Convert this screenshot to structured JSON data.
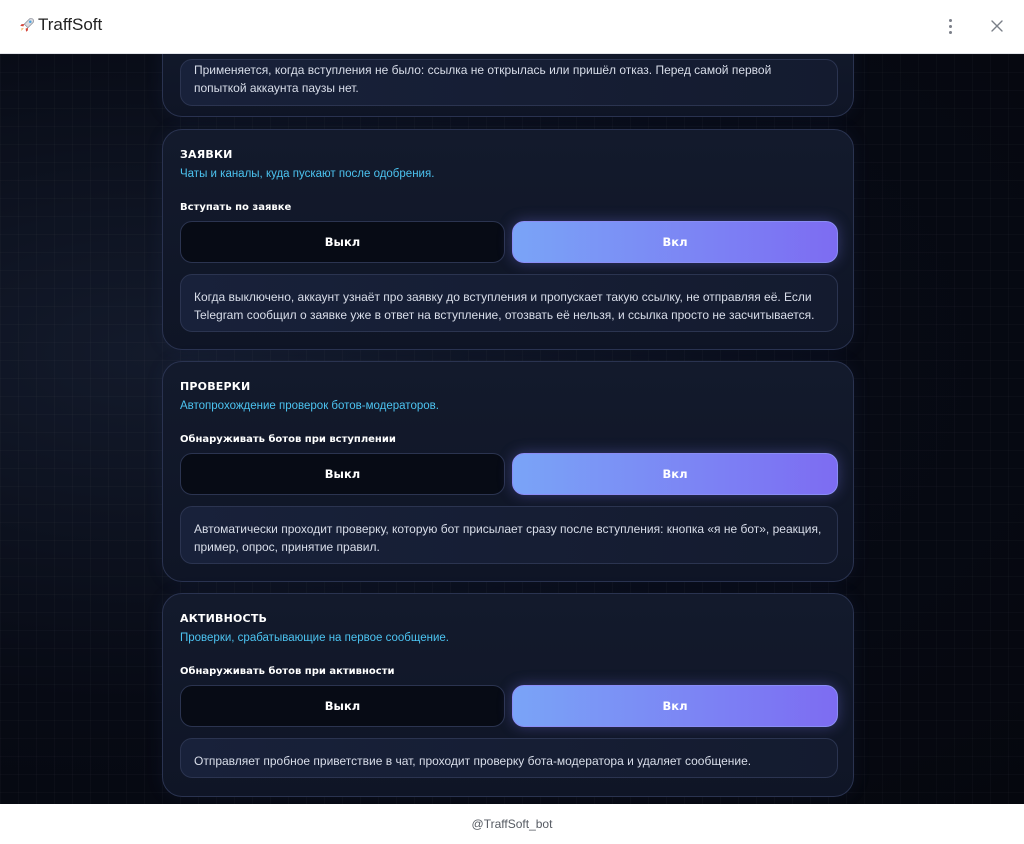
{
  "app": {
    "title": "TraffSoft"
  },
  "top_note": {
    "text": "Применяется, когда вступления не было: ссылка не открылась или пришёл отказ. Перед самой первой попыткой аккаунта паузы нет."
  },
  "sections": [
    {
      "title": "ЗАЯВКИ",
      "subtitle": "Чаты и каналы, куда пускают после одобрения.",
      "field_label": "Вступать по заявке",
      "off_label": "Выкл",
      "on_label": "Вкл",
      "selected": "on",
      "note": "Когда выключено, аккаунт узнаёт про заявку до вступления и пропускает такую ссылку, не отправляя её. Если Telegram сообщил о заявке уже в ответ на вступление, отозвать её нельзя, и ссылка просто не засчитывается."
    },
    {
      "title": "ПРОВЕРКИ",
      "subtitle": "Автопрохождение проверок ботов-модераторов.",
      "field_label": "Обнаруживать ботов при вступлении",
      "off_label": "Выкл",
      "on_label": "Вкл",
      "selected": "on",
      "note": "Автоматически проходит проверку, которую бот присылает сразу после вступления: кнопка «я не бот», реакция, пример, опрос, принятие правил."
    },
    {
      "title": "АКТИВНОСТЬ",
      "subtitle": "Проверки, срабатывающие на первое сообщение.",
      "field_label": "Обнаруживать ботов при активности",
      "off_label": "Выкл",
      "on_label": "Вкл",
      "selected": "on",
      "note": "Отправляет пробное приветствие в чат, проходит проверку бота-модератора и удаляет сообщение."
    }
  ],
  "footer": {
    "text": "@TraffSoft_bot"
  },
  "icons": {
    "app": "rocket-icon",
    "menu": "more-vertical-icon",
    "close": "close-icon"
  },
  "colors": {
    "accent_start": "#7aa4f7",
    "accent_end": "#7d6cf2",
    "subtitle": "#4cc3f0",
    "background": "#070a14"
  }
}
